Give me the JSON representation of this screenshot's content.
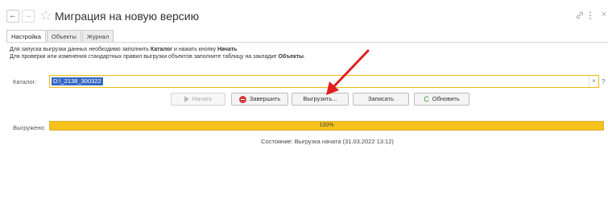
{
  "window": {
    "title": "Миграция на новую версию",
    "back_icon": "←",
    "forward_icon": "→",
    "favorite_icon": "☆",
    "link_icon": "🔗",
    "menu_icon": "⋮",
    "close_icon": "×"
  },
  "tabs": [
    {
      "label": "Настройка",
      "active": true
    },
    {
      "label": "Объекты",
      "active": false
    },
    {
      "label": "Журнал",
      "active": false
    }
  ],
  "hints": {
    "line1_a": "Для запуска выгрузки данных необходимо заполнить ",
    "line1_b": "Каталог",
    "line1_c": " и нажать кнопку ",
    "line1_d": "Начать",
    "line2_a": "Для проверки или изменения стандартных правил выгрузки объектов заполните таблицу на закладке ",
    "line2_b": "Объекты",
    "line2_c": "."
  },
  "catalog": {
    "label": "Каталог:",
    "value": "D:\\_2138_300322",
    "clear_icon": "×",
    "help_icon": "?"
  },
  "buttons": {
    "start": "Начать",
    "finish": "Завершить",
    "export": "Выгрузить...",
    "save": "Записать",
    "refresh": "Обновить",
    "refresh_icon": "C"
  },
  "progress": {
    "label": "Выгружено:",
    "percent_text": "100%",
    "fraction": 1.0
  },
  "status": {
    "text": "Состояние: Выгрузка начата (31.03.2022 13:12)"
  },
  "colors": {
    "accent_yellow": "#f7c21c",
    "selection_blue": "#3769c4",
    "annotation_red": "#e31e1e"
  }
}
